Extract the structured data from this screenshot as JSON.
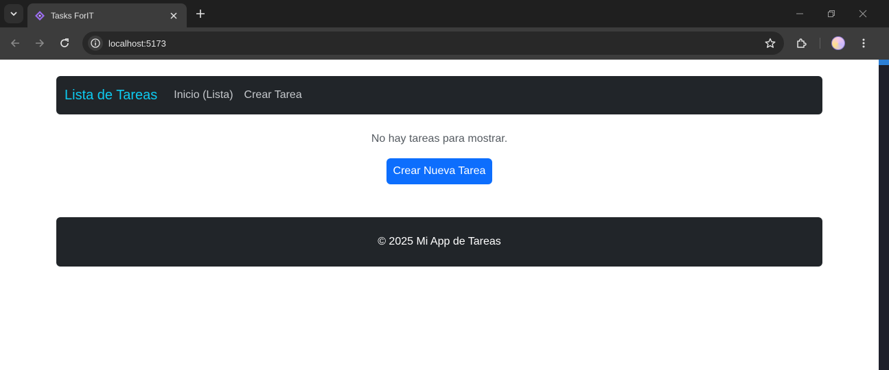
{
  "browser": {
    "tab_title": "Tasks ForIT",
    "url": "localhost:5173"
  },
  "navbar": {
    "brand": "Lista de Tareas",
    "links": [
      "Inicio (Lista)",
      "Crear Tarea"
    ]
  },
  "main": {
    "empty_message": "No hay tareas para mostrar.",
    "create_button": "Crear Nueva Tarea"
  },
  "footer": {
    "text": "© 2025 Mi App de Tareas"
  },
  "colors": {
    "brand": "#0dcaf0",
    "primary": "#0d6efd",
    "dark": "#212529"
  }
}
